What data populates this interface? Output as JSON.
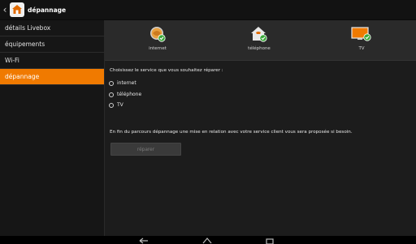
{
  "actionbar": {
    "title": "dépannage"
  },
  "sidebar": {
    "items": [
      {
        "label": "détails Livebox",
        "active": false
      },
      {
        "label": "équipements",
        "active": false
      },
      {
        "label": "Wi-Fi",
        "active": false
      },
      {
        "label": "dépannage",
        "active": true
      }
    ]
  },
  "services": [
    {
      "label": "internet",
      "icon": "globe-icon"
    },
    {
      "label": "téléphone",
      "icon": "home-phone-icon"
    },
    {
      "label": "TV",
      "icon": "tv-icon"
    }
  ],
  "main": {
    "prompt": "Choisissez le service que vous souhaitez réparer :",
    "options": [
      "internet",
      "téléphone",
      "TV"
    ],
    "info": "En fin du parcours dépannage une mise en relation avec votre service client vous sera proposée si besoin.",
    "repair_label": "réparer"
  },
  "colors": {
    "accent": "#f07a00",
    "check": "#3aa83a"
  }
}
